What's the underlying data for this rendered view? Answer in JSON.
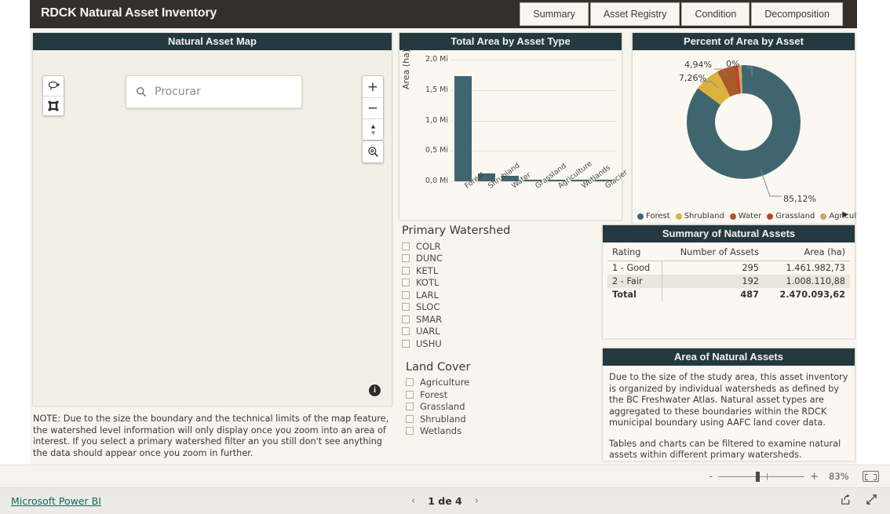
{
  "header": {
    "title": "RDCK Natural Asset Inventory",
    "tabs": [
      {
        "label": "Summary"
      },
      {
        "label": "Asset Registry"
      },
      {
        "label": "Condition"
      },
      {
        "label": "Decomposition"
      }
    ]
  },
  "map": {
    "title": "Natural Asset Map",
    "search_placeholder": "Procurar",
    "search_value": "",
    "tools": {
      "lasso": "lasso-select",
      "rectangle": "rectangle-select",
      "zoom_in": "+",
      "zoom_out": "−",
      "compass": "compass",
      "magnify": "magnify",
      "info": "i"
    },
    "note": "NOTE: Due to the size the boundary and the technical limits of the map feature, the watershed level information will only display once you zoom into an area of interest. If you select a primary watershed filter an you still don't see anything the data should appear once you zoom in further."
  },
  "filters": {
    "watershed_title": "Primary Watershed",
    "watershed_items": [
      {
        "label": "COLR",
        "checked": false
      },
      {
        "label": "DUNC",
        "checked": false
      },
      {
        "label": "KETL",
        "checked": false
      },
      {
        "label": "KOTL",
        "checked": false
      },
      {
        "label": "LARL",
        "checked": false
      },
      {
        "label": "SLOC",
        "checked": false
      },
      {
        "label": "SMAR",
        "checked": false
      },
      {
        "label": "UARL",
        "checked": false
      },
      {
        "label": "USHU",
        "checked": false
      }
    ],
    "landcover_title": "Land Cover",
    "landcover_items": [
      {
        "label": "Agriculture",
        "checked": false
      },
      {
        "label": "Forest",
        "checked": false
      },
      {
        "label": "Grassland",
        "checked": false
      },
      {
        "label": "Shrubland",
        "checked": false
      },
      {
        "label": "Wetlands",
        "checked": false
      }
    ]
  },
  "summary_table": {
    "title": "Summary of Natural Assets",
    "columns": [
      "Rating",
      "Number of Assets",
      "Area (ha)"
    ],
    "rows": [
      {
        "rating": "1 - Good",
        "count": "295",
        "area": "1.461.982,73"
      },
      {
        "rating": "2 - Fair",
        "count": "192",
        "area": "1.008.110,88"
      }
    ],
    "total": {
      "rating": "Total",
      "count": "487",
      "area": "2.470.093,62"
    }
  },
  "info_panel": {
    "title": "Area of Natural Assets",
    "paragraph1": "Due to the size of the study area, this asset inventory is organized by individual watersheds as defined by the BC Freshwater Atlas. Natural asset types are aggregated to these boundaries within the RDCK municipal boundary using AAFC land cover data.",
    "paragraph2": "Tables and charts can be filtered to examine natural assets within different primary watersheds."
  },
  "statusbar": {
    "zoom_out_label": "-",
    "zoom_in_label": "+",
    "zoom_percent": "83%",
    "fit_label": "fit-to-page"
  },
  "footer": {
    "brand": "Microsoft Power BI",
    "prev": "‹",
    "page_label": "1 de 4",
    "next": "›",
    "share_icon": "share-icon",
    "fullscreen_icon": "fullscreen-icon"
  },
  "chart_data": [
    {
      "type": "bar",
      "title": "Total Area by Asset Type",
      "xlabel": "",
      "ylabel": "Area (ha)",
      "categories": [
        "Forest",
        "Shrubland",
        "Water",
        "Grassland",
        "Agriculture",
        "Wetlands",
        "Glacier"
      ],
      "values": [
        1730000,
        135000,
        95000,
        25000,
        14000,
        9000,
        5000
      ],
      "ytick_labels": [
        "0,0 Mi",
        "0,5 Mi",
        "1,0 Mi",
        "1,5 Mi",
        "2,0 Mi"
      ],
      "ylim": [
        0,
        2000000
      ],
      "grid": true,
      "bar_color": "#3f6670"
    },
    {
      "type": "pie",
      "title": "Percent of Area by Asset",
      "donut": true,
      "legend_position": "bottom",
      "labels": [
        "Forest",
        "Shrubland",
        "Water",
        "Grassland",
        "Agriculture"
      ],
      "values": [
        85.12,
        7.26,
        4.94,
        0.0,
        0.0
      ],
      "value_labels": [
        "85,12%",
        "7,26%",
        "4,94%",
        "0%",
        ""
      ],
      "colors": [
        "#3f6670",
        "#dcb13f",
        "#a9592c",
        "#c2412c",
        "#d2a271"
      ],
      "legend_more": "▶"
    }
  ]
}
